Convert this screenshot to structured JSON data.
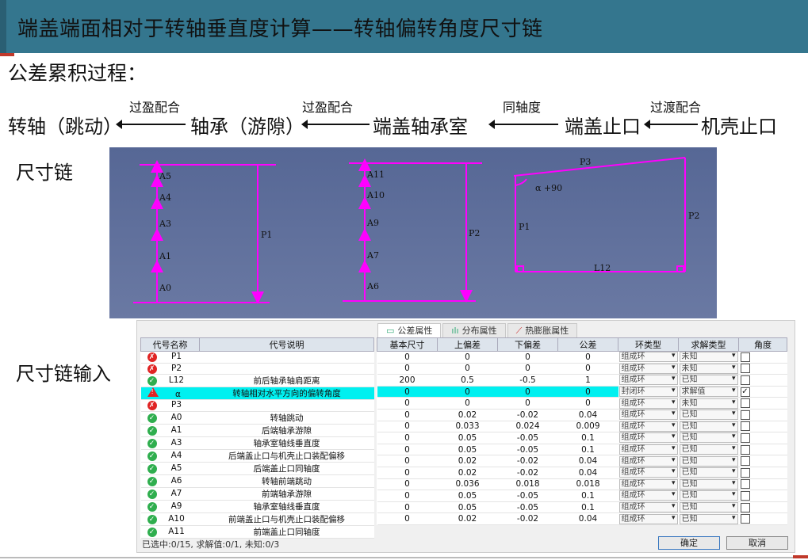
{
  "title": "端盖端面相对于转轴垂直度计算——转轴偏转角度尺寸链",
  "subtitle": "公差累积过程：",
  "flow": {
    "nodes": [
      "转轴（跳动）",
      "轴承（游隙）",
      "端盖轴承室",
      "端盖止口",
      "机壳止口"
    ],
    "links": [
      "过盈配合",
      "过盈配合",
      "同轴度",
      "过渡配合"
    ]
  },
  "sections": {
    "chain": "尺寸链",
    "input": "尺寸链输入"
  },
  "diagram": {
    "chain1": {
      "labels": [
        "A5",
        "A4",
        "A3",
        "A1",
        "A0"
      ],
      "closing": "P1"
    },
    "chain2": {
      "labels": [
        "A11",
        "A10",
        "A9",
        "A7",
        "A6"
      ],
      "closing": "P2"
    },
    "chain3": {
      "top": "P3",
      "angle": "α +90",
      "left": "P1",
      "right": "P2",
      "bottom": "L12"
    },
    "line_color": "#ff00ff"
  },
  "dialog": {
    "tabs": [
      "公差属性",
      "分布属性",
      "热膨胀属性"
    ],
    "left_headers": [
      "代号名称",
      "代号说明"
    ],
    "right_headers": [
      "基本尺寸",
      "上偏差",
      "下偏差",
      "公差",
      "环类型",
      "求解类型",
      "角度"
    ],
    "rows": [
      {
        "status": "err",
        "code": "P1",
        "desc": "",
        "basic": "0",
        "upper": "0",
        "lower": "0",
        "tol": "0",
        "ring": "组成环",
        "solve": "未知",
        "angle": false
      },
      {
        "status": "err",
        "code": "P2",
        "desc": "",
        "basic": "0",
        "upper": "0",
        "lower": "0",
        "tol": "0",
        "ring": "组成环",
        "solve": "未知",
        "angle": false
      },
      {
        "status": "ok",
        "code": "L12",
        "desc": "前后轴承轴肩距离",
        "basic": "200",
        "upper": "0.5",
        "lower": "-0.5",
        "tol": "1",
        "ring": "组成环",
        "solve": "已知",
        "angle": false
      },
      {
        "status": "warn",
        "code": "α",
        "desc": "转轴相对水平方向的偏转角度",
        "basic": "0",
        "upper": "0",
        "lower": "0",
        "tol": "0",
        "ring": "封闭环",
        "solve": "求解值",
        "angle": true,
        "highlight": true
      },
      {
        "status": "err",
        "code": "P3",
        "desc": "",
        "basic": "0",
        "upper": "0",
        "lower": "0",
        "tol": "0",
        "ring": "组成环",
        "solve": "未知",
        "angle": false
      },
      {
        "status": "ok",
        "code": "A0",
        "desc": "转轴跳动",
        "basic": "0",
        "upper": "0.02",
        "lower": "-0.02",
        "tol": "0.04",
        "ring": "组成环",
        "solve": "已知",
        "angle": false
      },
      {
        "status": "ok",
        "code": "A1",
        "desc": "后端轴承游隙",
        "basic": "0",
        "upper": "0.033",
        "lower": "0.024",
        "tol": "0.009",
        "ring": "组成环",
        "solve": "已知",
        "angle": false
      },
      {
        "status": "ok",
        "code": "A3",
        "desc": "轴承室轴线垂直度",
        "basic": "0",
        "upper": "0.05",
        "lower": "-0.05",
        "tol": "0.1",
        "ring": "组成环",
        "solve": "已知",
        "angle": false
      },
      {
        "status": "ok",
        "code": "A4",
        "desc": "后端盖止口与机壳止口装配偏移",
        "basic": "0",
        "upper": "0.05",
        "lower": "-0.05",
        "tol": "0.1",
        "ring": "组成环",
        "solve": "已知",
        "angle": false
      },
      {
        "status": "ok",
        "code": "A5",
        "desc": "后端盖止口同轴度",
        "basic": "0",
        "upper": "0.02",
        "lower": "-0.02",
        "tol": "0.04",
        "ring": "组成环",
        "solve": "已知",
        "angle": false
      },
      {
        "status": "ok",
        "code": "A6",
        "desc": "转轴前端跳动",
        "basic": "0",
        "upper": "0.02",
        "lower": "-0.02",
        "tol": "0.04",
        "ring": "组成环",
        "solve": "已知",
        "angle": false
      },
      {
        "status": "ok",
        "code": "A7",
        "desc": "前端轴承游隙",
        "basic": "0",
        "upper": "0.036",
        "lower": "0.018",
        "tol": "0.018",
        "ring": "组成环",
        "solve": "已知",
        "angle": false
      },
      {
        "status": "ok",
        "code": "A9",
        "desc": "轴承室轴线垂直度",
        "basic": "0",
        "upper": "0.05",
        "lower": "-0.05",
        "tol": "0.1",
        "ring": "组成环",
        "solve": "已知",
        "angle": false
      },
      {
        "status": "ok",
        "code": "A10",
        "desc": "前端盖止口与机壳止口装配偏移",
        "basic": "0",
        "upper": "0.05",
        "lower": "-0.05",
        "tol": "0.1",
        "ring": "组成环",
        "solve": "已知",
        "angle": false
      },
      {
        "status": "ok",
        "code": "A11",
        "desc": "前端盖止口同轴度",
        "basic": "0",
        "upper": "0.02",
        "lower": "-0.02",
        "tol": "0.04",
        "ring": "组成环",
        "solve": "已知",
        "angle": false
      }
    ],
    "status_text": "已选中:0/15, 求解值:0/1, 未知:0/3",
    "ok_label": "确定",
    "cancel_label": "取消"
  }
}
